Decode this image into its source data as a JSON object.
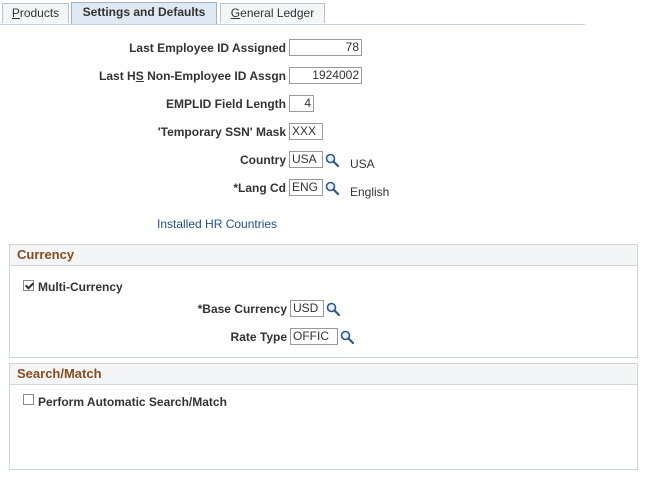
{
  "tabs": [
    {
      "label_pre": "",
      "label_u": "P",
      "label_post": "roducts"
    },
    {
      "label": "Settings and Defaults"
    },
    {
      "label_pre": "",
      "label_u": "G",
      "label_post": "eneral Ledger"
    }
  ],
  "fields": {
    "last_employee_id": {
      "label": "Last Employee ID Assigned",
      "value": "78"
    },
    "last_hs_nonemp": {
      "label_pre": "Last H",
      "label_u": "S",
      "label_post": " Non-Employee ID Assgn",
      "value": "1924002"
    },
    "emplid_length": {
      "label": "EMPLID Field Length",
      "value": "4"
    },
    "temp_ssn_mask": {
      "label": "'Temporary SSN' Mask",
      "value": "XXX"
    },
    "country": {
      "label": "Country",
      "value": "USA",
      "desc": "USA"
    },
    "lang_cd": {
      "label": "*Lang Cd",
      "value": "ENG",
      "desc": "English"
    }
  },
  "installed_hr_countries": "Installed HR Countries",
  "currency": {
    "header": "Currency",
    "multi_currency_label": "Multi-Currency",
    "multi_currency_checked": true,
    "base_currency_label": "*Base Currency",
    "base_currency_value": "USD",
    "rate_type_label": "Rate Type",
    "rate_type_value": "OFFIC"
  },
  "search_match": {
    "header": "Search/Match",
    "auto_label": "Perform Automatic Search/Match",
    "auto_checked": false
  },
  "icons": {
    "lookup": "magnifier-lookup-icon"
  }
}
